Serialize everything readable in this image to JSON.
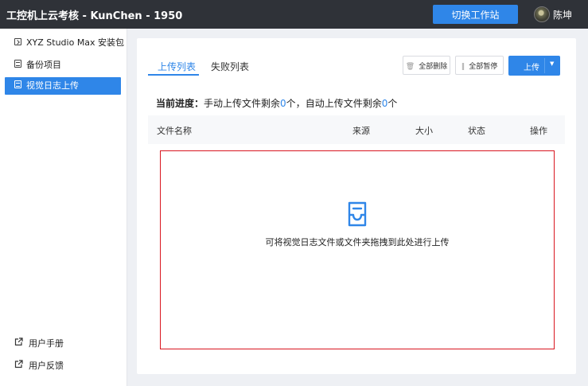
{
  "app": {
    "title": "工控机上云考核 - KunChen - 1950",
    "switch_button": "切换工作站",
    "user_name": "陈坤"
  },
  "sidebar": {
    "items": [
      {
        "label": "XYZ Studio Max 安装包",
        "icon": "package-icon"
      },
      {
        "label": "备份项目",
        "icon": "backup-icon"
      },
      {
        "label": "视觉日志上传",
        "icon": "document-icon",
        "active": true
      }
    ],
    "footer": [
      {
        "label": "用户手册",
        "icon": "external-link-icon"
      },
      {
        "label": "用户反馈",
        "icon": "external-link-icon"
      }
    ]
  },
  "main": {
    "tabs": [
      {
        "label": "上传列表",
        "active": true
      },
      {
        "label": "失败列表",
        "active": false
      }
    ],
    "toolbar": {
      "delete_all": "全部删除",
      "pause_all": "全部暂停",
      "upload": "上传"
    },
    "progress": {
      "prefix": "当前进度：",
      "manual_text": "手动上传文件剩余",
      "manual_count": "0",
      "unit1": "个，",
      "auto_text": "自动上传文件剩余",
      "auto_count": "0",
      "unit2": "个"
    },
    "table": {
      "columns": [
        "文件名称",
        "来源",
        "大小",
        "状态",
        "操作"
      ]
    },
    "dropzone": {
      "text": "可将视觉日志文件或文件夹拖拽到此处进行上传",
      "icon": "inbox-upload-icon"
    }
  },
  "colors": {
    "accent": "#2f86e8",
    "topbar": "#2f3238",
    "highlight_border": "#d9161f"
  }
}
